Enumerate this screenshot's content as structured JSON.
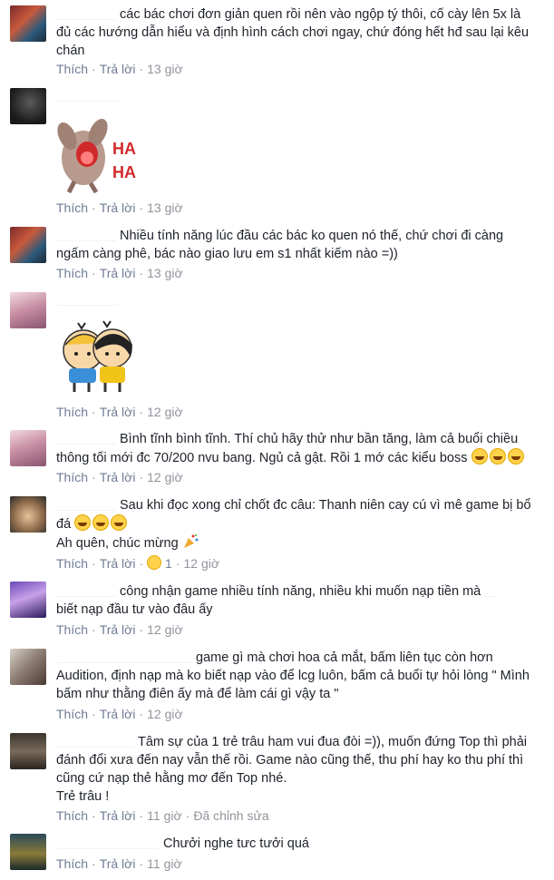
{
  "actions": {
    "like": "Thích",
    "reply": "Trả lời",
    "dot": "·"
  },
  "comments": [
    {
      "text": "các bác chơi đơn giản quen rồi nên vào ngộp tý thôi, cố cày lên 5x là đủ các hướng dẫn hiểu và định hình cách chơi ngay, chứ đóng hết hđ sau lại kêu chán",
      "time": "13 giờ"
    },
    {
      "text": "",
      "time": "13 giờ",
      "sticker": "HA HA"
    },
    {
      "text": "Nhiều tính năng lúc đầu các bác ko quen nó thế, chứ chơi đi càng ngấm càng phê, bác nào giao lưu em s1 nhất kiếm nào =))",
      "time": "13 giờ"
    },
    {
      "text": "",
      "time": "12 giờ"
    },
    {
      "text": "Bình tĩnh bình tĩnh. Thí chủ hãy thử như bần tăng, làm cả buổi chiều thông tối mới đc 70/200 nvu bang. Ngủ cả gật. Rồi 1 mớ các kiểu boss",
      "time": "12 giờ"
    },
    {
      "text": "Sau khi đọc xong chỉ chốt đc câu: Thanh niên cay cú vì mê game bị bổ đá",
      "text2": "Ah quên, chúc mừng",
      "time": "12 giờ",
      "reaction_count": "1"
    },
    {
      "text": "công nhận game nhiều tính năng, nhiều khi muốn nạp tiền mà",
      "text_b": "biết nạp đầu tư vào đâu ấy",
      "time": "12 giờ"
    },
    {
      "text": "game gì mà chơi hoa cả mắt, bấm liên tục còn hơn Audition, định nạp mà ko biết nạp vào để lcg luôn, bấm cả buổi tự hỏi lòng \" Mình bấm như thằng điên ấy mà để làm cái gì vậy ta \"",
      "time": "12 giờ"
    },
    {
      "text": "Tâm sự của 1 trẻ trâu ham vui đua đòi =)), muốn đứng Top thì phải đánh đổi xưa đến nay vẫn thế rồi. Game nào cũng thế, thu phí hay ko thu phí thì cũng cứ nạp thẻ hằng mơ đến Top nhé.",
      "text2": "Trẻ trâu !",
      "time": "11 giờ",
      "edited": "Đã chỉnh sửa"
    },
    {
      "text": "Chưởi nghe tưc tưởi quá",
      "time": "11 giờ"
    }
  ],
  "colors": {
    "link": "#6f7c96",
    "text": "#1d2129"
  }
}
